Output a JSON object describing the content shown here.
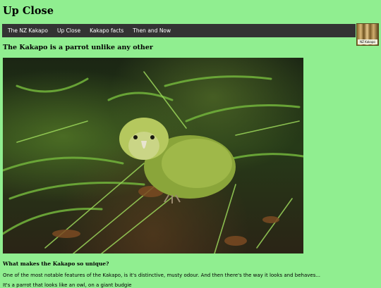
{
  "header": {
    "title": "Up Close"
  },
  "nav": {
    "items": [
      {
        "label": "The NZ Kakapo"
      },
      {
        "label": "Up Close"
      },
      {
        "label": "Kakapo facts"
      },
      {
        "label": "Then and Now"
      }
    ]
  },
  "logo": {
    "caption": "NZ Kakapo"
  },
  "main": {
    "subtitle": "The Kakapo is a parrot unlike any other",
    "section_heading": "What makes the Kakapo so unique?",
    "paragraph_1": "One of the most notable features of the Kakapo, is it's distinctive, musty odour. And then there's the way it looks and behaves...",
    "paragraph_2": "It's a parrot that looks like an owl, on a giant budgie"
  },
  "colors": {
    "page_background": "#90ee90",
    "navbar_background": "#333333",
    "navbar_text": "#ffffff"
  }
}
